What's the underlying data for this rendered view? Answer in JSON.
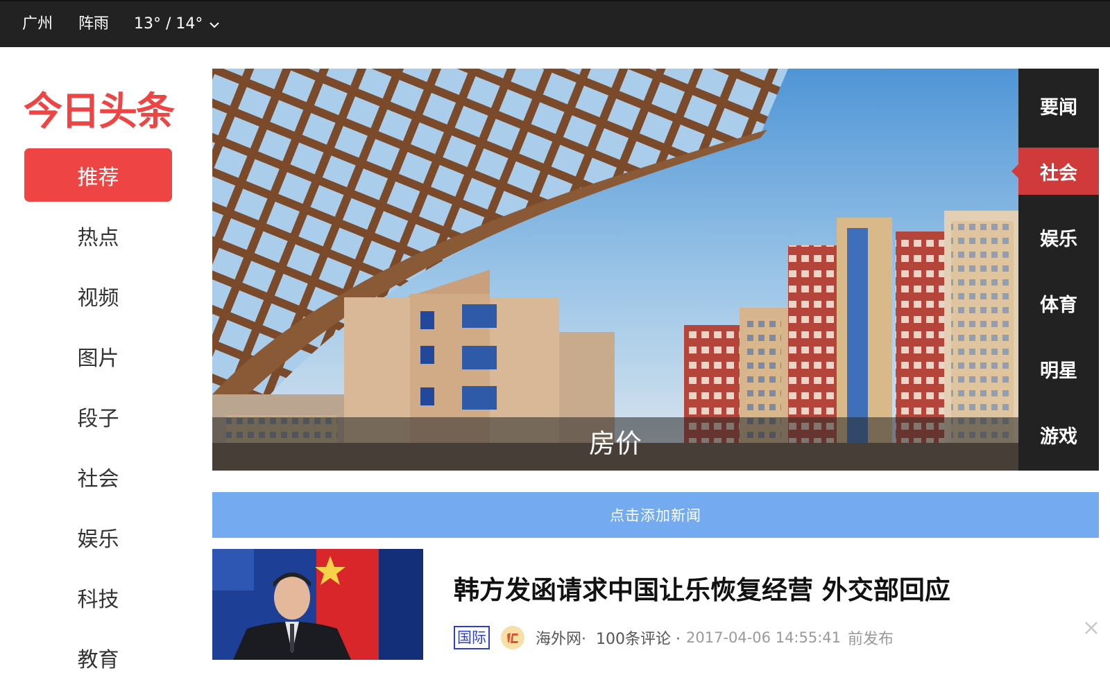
{
  "topbar": {
    "city": "广州",
    "weather": "阵雨",
    "temperature": "13° / 14°",
    "dropdown_icon": "chevron-down-icon"
  },
  "brand": {
    "logo_text": "今日头条",
    "logo_color": "#ef4444"
  },
  "sidebar": {
    "items": [
      {
        "label": "推荐",
        "active": true
      },
      {
        "label": "热点",
        "active": false
      },
      {
        "label": "视频",
        "active": false
      },
      {
        "label": "图片",
        "active": false
      },
      {
        "label": "段子",
        "active": false
      },
      {
        "label": "社会",
        "active": false
      },
      {
        "label": "娱乐",
        "active": false
      },
      {
        "label": "科技",
        "active": false
      },
      {
        "label": "教育",
        "active": false
      }
    ]
  },
  "banner": {
    "caption": "房价",
    "image_subject": "buildings-under-glass-canopy"
  },
  "categories": {
    "items": [
      {
        "label": "要闻",
        "active": false
      },
      {
        "label": "社会",
        "active": true
      },
      {
        "label": "娱乐",
        "active": false
      },
      {
        "label": "体育",
        "active": false
      },
      {
        "label": "明星",
        "active": false
      },
      {
        "label": "游戏",
        "active": false
      }
    ]
  },
  "add_news": {
    "label": "点击添加新闻"
  },
  "feed": {
    "items": [
      {
        "title": "韩方发函请求中国让乐恢复经营 外交部回应",
        "tag": "国际",
        "source": "海外网·",
        "comments": "100条评论 ·",
        "time": "2017-04-06 14:55:41",
        "time_suffix": "前发布",
        "close_icon": "close-icon"
      }
    ]
  },
  "colors": {
    "topbar_bg": "#222222",
    "accent_red": "#ef4444",
    "add_news_bg": "#74abf0",
    "tag_blue": "#2b3fd6"
  }
}
